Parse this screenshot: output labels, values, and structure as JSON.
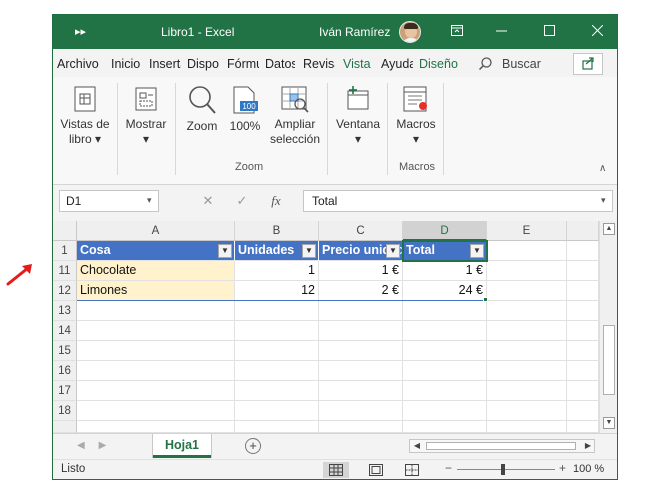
{
  "window": {
    "title": "Libro1  -  Excel",
    "user_name": "Iván Ramírez",
    "qat_label": "▸▸"
  },
  "tabs": [
    {
      "label": "Archivo"
    },
    {
      "label": "Inicio"
    },
    {
      "label": "Inserta"
    },
    {
      "label": "Disposición"
    },
    {
      "label": "Fórmulas"
    },
    {
      "label": "Datos"
    },
    {
      "label": "Revisar"
    },
    {
      "label": "Vista",
      "active": true
    },
    {
      "label": "Ayuda"
    },
    {
      "label": "Diseño"
    }
  ],
  "search_label": "Buscar",
  "ribbon": {
    "vistas_libro": [
      "Vistas de",
      "libro ▾"
    ],
    "mostrar": "Mostrar",
    "mostrar_arrow": "▾",
    "zoom": "Zoom",
    "zoom100": "100%",
    "ampliar": [
      "Ampliar",
      "selección"
    ],
    "ventana": "Ventana",
    "ventana_arrow": "▾",
    "macros": "Macros",
    "macros_arrow": "▾",
    "group_zoom": "Zoom",
    "group_macros": "Macros",
    "collapse": "∧"
  },
  "formula_bar": {
    "name_box": "D1",
    "value": "Total"
  },
  "columns": [
    "A",
    "B",
    "C",
    "D",
    "E"
  ],
  "rows": [
    "1",
    "11",
    "12",
    "13",
    "14",
    "15",
    "16",
    "17",
    "18"
  ],
  "table": {
    "headers": [
      "Cosa",
      "Unidades",
      "Precio unidad",
      "Total"
    ],
    "rows": [
      [
        "Chocolate",
        "1",
        "1 €",
        "1 €"
      ],
      [
        "Limones",
        "12",
        "2 €",
        "24 €"
      ]
    ]
  },
  "sheet": {
    "tab_name": "Hoja1"
  },
  "status": {
    "mode": "Listo",
    "zoom_level": "100 %"
  },
  "colors": {
    "accent": "#217346",
    "table_header": "#4472c4",
    "highlight": "#fff2cc",
    "arrow": "#e41b1b"
  }
}
